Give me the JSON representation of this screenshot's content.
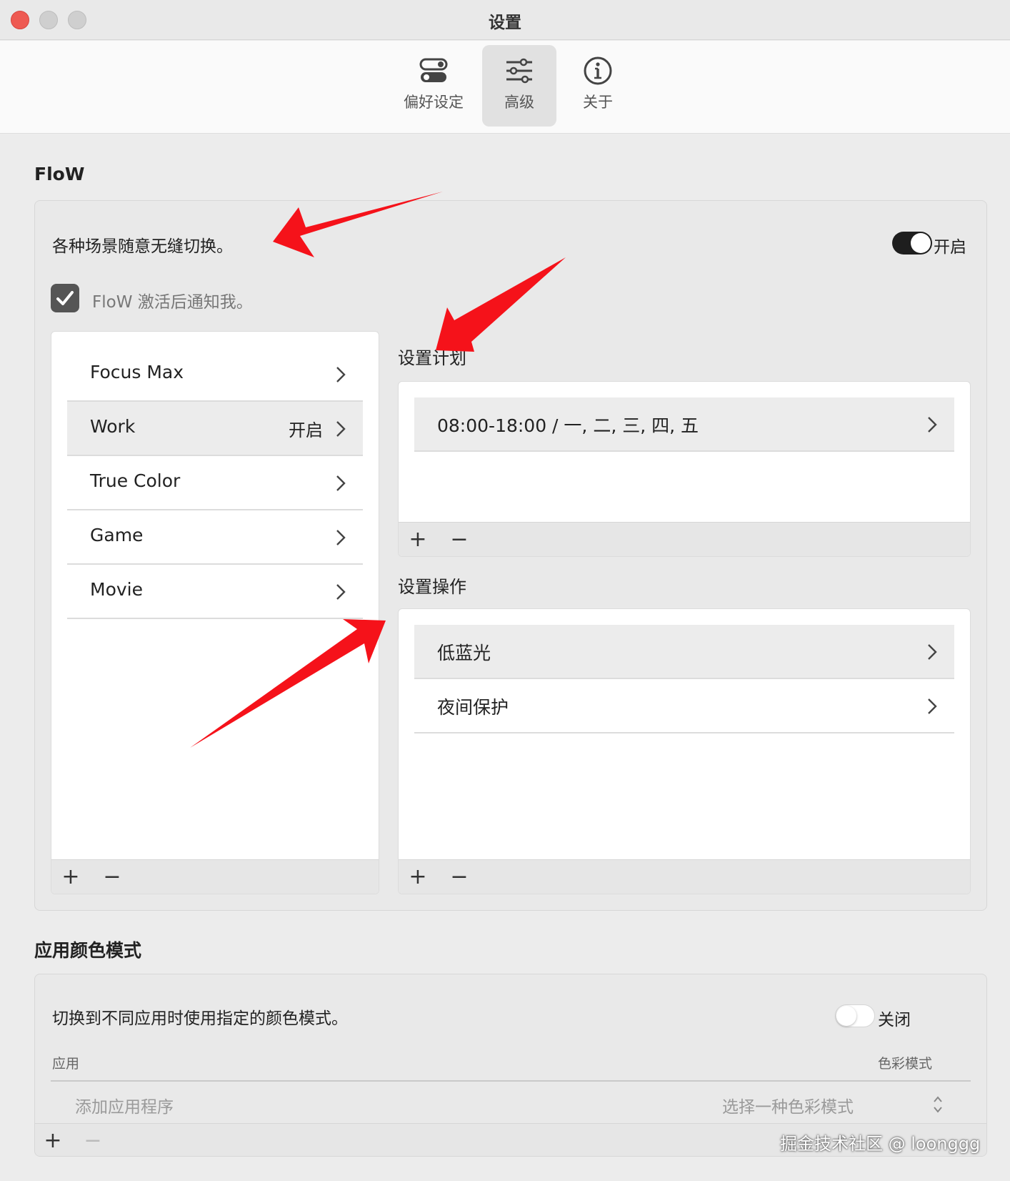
{
  "window": {
    "title": "设置"
  },
  "toolbar": {
    "tabs": [
      {
        "label": "偏好设定",
        "icon": "toggles-icon"
      },
      {
        "label": "高级",
        "icon": "sliders-icon",
        "active": true
      },
      {
        "label": "关于",
        "icon": "info-icon"
      }
    ]
  },
  "flow": {
    "section_title": "FloW",
    "description": "各种场景随意无缝切换。",
    "toggle_state_label": "开启",
    "toggle_on": true,
    "notify_label": "FloW 激活后通知我。",
    "notify_checked": true,
    "scenes": [
      {
        "label": "Focus Max",
        "badge": ""
      },
      {
        "label": "Work",
        "badge": "开启",
        "selected": true
      },
      {
        "label": "True Color",
        "badge": ""
      },
      {
        "label": "Game",
        "badge": ""
      },
      {
        "label": "Movie",
        "badge": ""
      }
    ],
    "schedule_title": "设置计划",
    "schedule_items": [
      {
        "label": "08:00-18:00 / 一, 二, 三, 四, 五"
      }
    ],
    "actions_title": "设置操作",
    "action_items": [
      {
        "label": "低蓝光"
      },
      {
        "label": "夜间保护"
      }
    ],
    "add_label": "+",
    "remove_label": "−"
  },
  "color_mode": {
    "section_title": "应用颜色模式",
    "description": "切换到不同应用时使用指定的颜色模式。",
    "toggle_state_label": "关闭",
    "toggle_on": false,
    "col_app": "应用",
    "col_mode": "色彩模式",
    "add_app_placeholder": "添加应用程序",
    "select_mode_placeholder": "选择一种色彩模式",
    "add_label": "+",
    "remove_label": "−"
  },
  "watermark": "掘金技术社区 @ loonggg",
  "colors": {
    "arrow": "#f5121a",
    "toggle_on": "#1e1e1e"
  }
}
